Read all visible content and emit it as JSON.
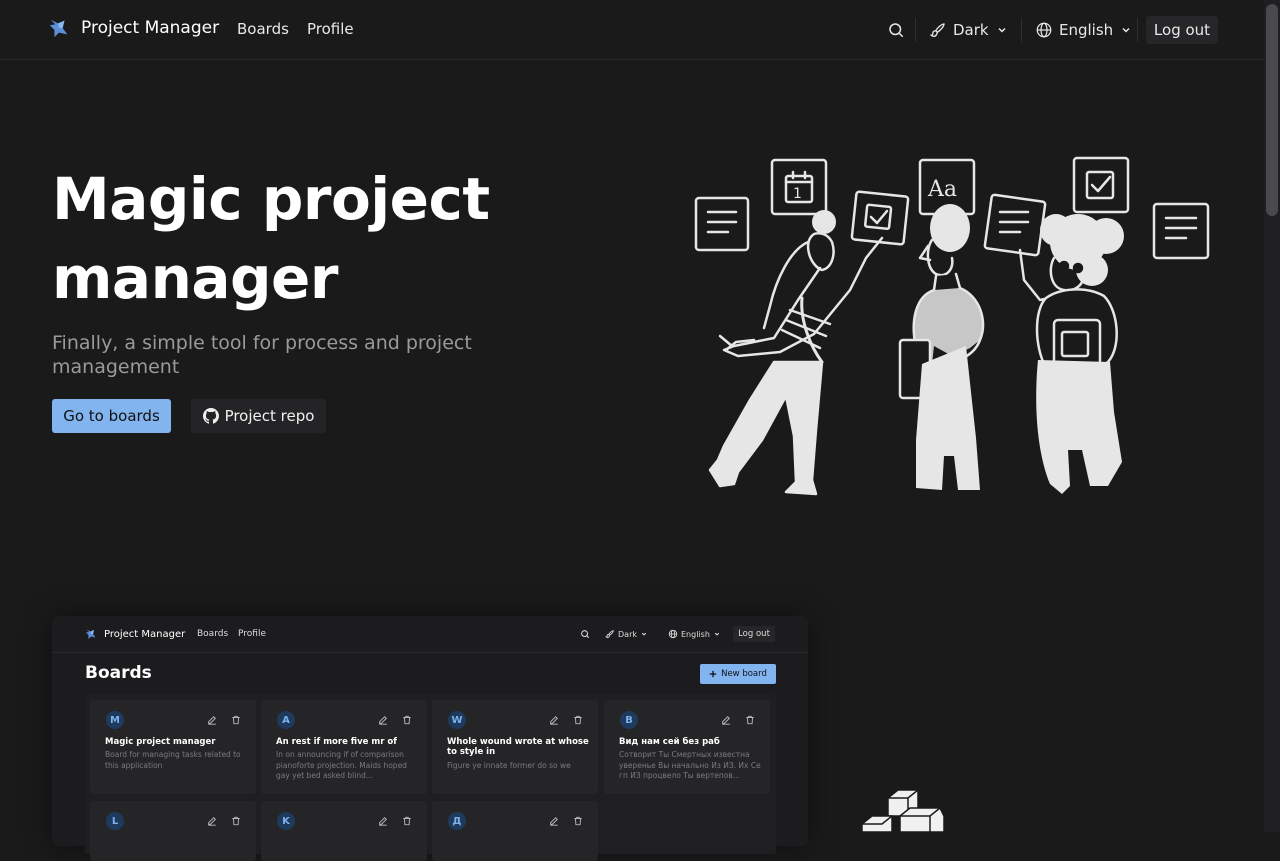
{
  "header": {
    "brand": "Project Manager",
    "nav": [
      "Boards",
      "Profile"
    ],
    "theme_label": "Dark",
    "language_label": "English",
    "logout_label": "Log out"
  },
  "hero": {
    "title": "Magic project manager",
    "subtitle": "Finally, a simple tool for process and project management",
    "primary_button": "Go to boards",
    "secondary_button": "Project repo"
  },
  "preview": {
    "brand": "Project Manager",
    "nav": [
      "Boards",
      "Profile"
    ],
    "theme_label": "Dark",
    "language_label": "English",
    "logout_label": "Log out",
    "page_title": "Boards",
    "new_board_label": "New board",
    "boards": [
      {
        "initial": "M",
        "title": "Magic project manager",
        "description": "Board for managing tasks related to this application"
      },
      {
        "initial": "A",
        "title": "An rest if more five mr of",
        "description": "In on announcing if of comparison pianoforte projection. Maids hoped gay yet bed asked blind..."
      },
      {
        "initial": "W",
        "title": "Whole wound wrote at whose to style in",
        "description": "Figure ye innate former do so we"
      },
      {
        "initial": "В",
        "title": "Вид нам сей без раб",
        "description": "Сотворит Ты Смертных известна уверенье Вы начально Из ИЗ. Их Се гп ИЗ процвело Ты вертепов..."
      },
      {
        "initial": "L",
        "title": "",
        "description": ""
      },
      {
        "initial": "K",
        "title": "",
        "description": ""
      },
      {
        "initial": "Д",
        "title": "",
        "description": ""
      }
    ]
  },
  "colors": {
    "background": "#1a1a1b",
    "accent": "#82b4f0",
    "avatar_bg": "#1e3a5c",
    "muted_text": "#9a9a9e"
  },
  "icons": [
    "logo-icon",
    "search-icon",
    "brush-icon",
    "globe-icon",
    "chevron-down-icon",
    "github-icon",
    "edit-icon",
    "trash-icon",
    "plus-icon"
  ]
}
